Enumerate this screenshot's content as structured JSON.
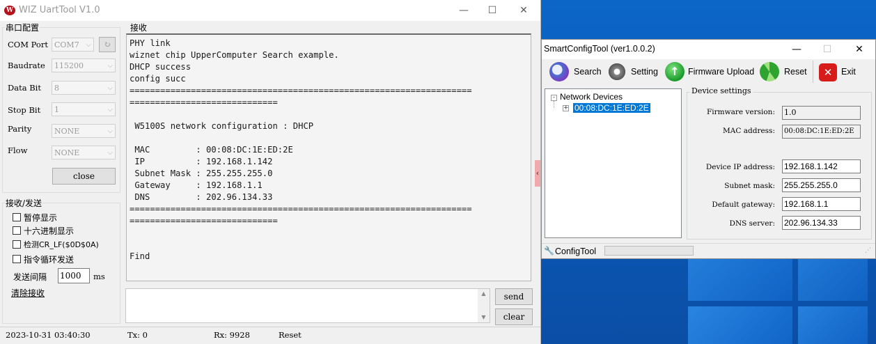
{
  "uart": {
    "title": "WIZ UartTool V1.0",
    "logo": "W",
    "serial_group": "串口配置",
    "fields": [
      {
        "label": "COM Port",
        "value": "COM7"
      },
      {
        "label": "Baudrate",
        "value": "115200"
      },
      {
        "label": "Data Bit",
        "value": "8"
      },
      {
        "label": "Stop Bit",
        "value": "1"
      },
      {
        "label": "Parity",
        "value": "NONE"
      },
      {
        "label": "Flow",
        "value": "NONE"
      }
    ],
    "close_label": "close",
    "rxtx_group": "接收/发送",
    "checks": [
      "暂停显示",
      "十六进制显示",
      "检测CR_LF($0D$0A)",
      "指令循环发送"
    ],
    "interval_label": "发送间隔",
    "interval_value": "1000",
    "interval_unit": "ms",
    "clear_recv": "清除接收",
    "recv_group": "接收",
    "recv_text": "PHY link\nwiznet chip UpperComputer Search example.\nDHCP success\nconfig succ\n===================================================================\n=============================\n\n W5100S network configuration : DHCP\n\n MAC         : 00:08:DC:1E:ED:2E\n IP          : 192.168.1.142\n Subnet Mask : 255.255.255.0\n Gateway     : 192.168.1.1\n DNS         : 202.96.134.33\n===================================================================\n=============================\n\n\nFind",
    "send_label": "send",
    "clear_label": "clear",
    "status": {
      "datetime": "2023-10-31 03:40:30",
      "tx": "Tx: 0",
      "rx": "Rx: 9928",
      "reset": "Reset"
    }
  },
  "sct": {
    "title": "SmartConfigTool (ver1.0.0.2)",
    "toolbar": [
      "Search",
      "Setting",
      "Firmware Upload",
      "Reset",
      "Exit"
    ],
    "tree_root": "Network Devices",
    "tree_device": "00:08:DC:1E:ED:2E",
    "settings_group": "Device settings",
    "settings": [
      {
        "label": "Firmware version:",
        "value": "1.0"
      },
      {
        "label": "MAC address:",
        "value": "00:08:DC:1E:ED:2E"
      },
      {
        "label": "Device IP address:",
        "value": "192.168.1.142"
      },
      {
        "label": "Subnet mask:",
        "value": "255.255.255.0"
      },
      {
        "label": "Default gateway:",
        "value": "192.168.1.1"
      },
      {
        "label": "DNS server:",
        "value": "202.96.134.33"
      }
    ],
    "status_label": "ConfigTool"
  },
  "colors": {
    "desktop_blue": "#0a5cc4",
    "selection": "#0078d7",
    "logo_red": "#b5121b"
  }
}
